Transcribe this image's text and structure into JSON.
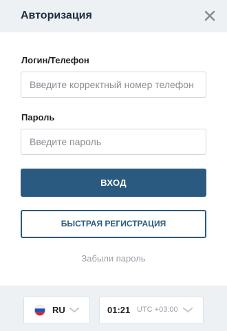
{
  "header": {
    "title": "Авторизация",
    "close_icon": "close-icon"
  },
  "form": {
    "login_label": "Логин/Телефон",
    "login_placeholder": "Введите корректный номер телефон",
    "login_value": "",
    "password_label": "Пароль",
    "password_placeholder": "Введите пароль",
    "password_value": "",
    "login_button": "ВХОД",
    "register_button": "БЫСТРАЯ РЕГИСТРАЦИЯ",
    "forgot_link": "Забыли пароль"
  },
  "footer": {
    "language": {
      "code": "RU",
      "flag_icon": "russia-flag-icon"
    },
    "time": {
      "value": "01:21",
      "timezone": "UTC +03:00"
    }
  },
  "colors": {
    "primary": "#2b5a80",
    "header_bg": "#edf1f4",
    "muted_text": "#9aa1a8"
  }
}
